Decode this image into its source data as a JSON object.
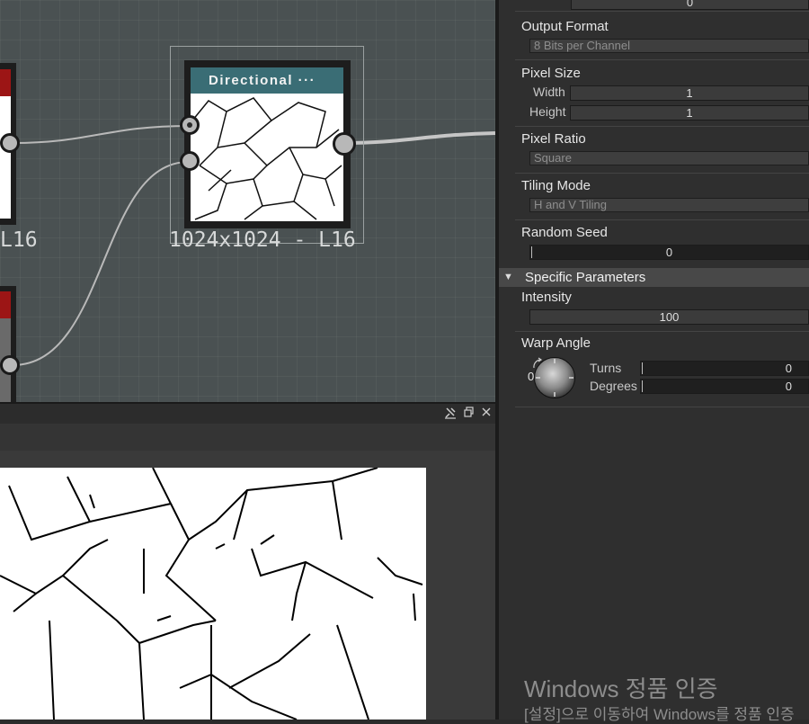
{
  "graph": {
    "node": {
      "title": "Directional ···",
      "resolution": "1024x1024 - L16",
      "header_color": "#3a6d75"
    },
    "left_node": {
      "resolution_partial": "L16",
      "header_color": "#9c1515"
    }
  },
  "properties": {
    "height_top_value": "0",
    "output_format": {
      "label": "Output Format",
      "value": "8 Bits per Channel"
    },
    "pixel_size": {
      "label": "Pixel Size",
      "width_label": "Width",
      "width_value": "1",
      "height_label": "Height",
      "height_value": "1"
    },
    "pixel_ratio": {
      "label": "Pixel Ratio",
      "value": "Square"
    },
    "tiling_mode": {
      "label": "Tiling Mode",
      "value": "H and V Tiling"
    },
    "random_seed": {
      "label": "Random Seed",
      "value": "0"
    },
    "specific_parameters": {
      "label": "Specific Parameters",
      "intensity_label": "Intensity",
      "intensity_value": "100",
      "warp_angle_label": "Warp Angle",
      "dial_zero": "0",
      "turns_label": "Turns",
      "turns_value": "0",
      "degrees_label": "Degrees",
      "degrees_value": "0"
    }
  },
  "view_panel": {
    "pin_icon": "pin-icon",
    "float_icon": "float-window-icon",
    "close_icon": "close-icon"
  },
  "watermark": {
    "title": "Windows 정품 인증",
    "subtitle": "[설정]으로 이동하여 Windows를 정품 인증"
  },
  "colors": {
    "graph_bg": "#4a5152",
    "panel_bg": "#2f2f2f",
    "section_header_bg": "#484848"
  }
}
